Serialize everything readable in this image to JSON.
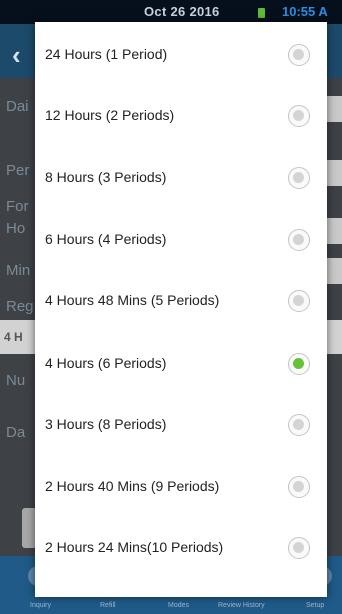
{
  "status_bar": {
    "date": "Oct 26 2016",
    "time": "10:55 A"
  },
  "background": {
    "back_icon": "‹",
    "labels": [
      "Dai",
      "Per",
      "For",
      "Ho",
      "Min",
      "Reg",
      "4 H",
      "Nu",
      "Da"
    ],
    "nav_items": [
      "Inquiry",
      "Refill",
      "Modes",
      "Review History",
      "Setup"
    ]
  },
  "dialog": {
    "options": [
      {
        "label": "24 Hours (1 Period)",
        "selected": false
      },
      {
        "label": "12 Hours (2 Periods)",
        "selected": false
      },
      {
        "label": "8 Hours (3 Periods)",
        "selected": false
      },
      {
        "label": "6 Hours (4 Periods)",
        "selected": false
      },
      {
        "label": "4 Hours 48 Mins (5 Periods)",
        "selected": false
      },
      {
        "label": "4 Hours (6 Periods)",
        "selected": true
      },
      {
        "label": "3 Hours (8 Periods)",
        "selected": false
      },
      {
        "label": "2 Hours 40 Mins (9 Periods)",
        "selected": false
      },
      {
        "label": "2 Hours 24 Mins(10 Periods)",
        "selected": false
      }
    ]
  },
  "colors": {
    "accent_selected": "#67c23a",
    "nav_bar": "#1f5a88",
    "title_bar": "#1c4a6a"
  }
}
